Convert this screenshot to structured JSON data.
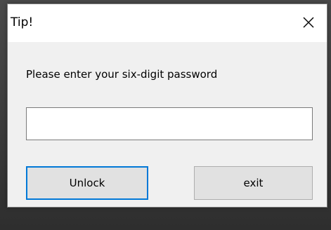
{
  "window": {
    "title": "Tip!",
    "close_icon": "close-icon"
  },
  "dialog": {
    "message": "Please enter your six-digit password",
    "password_value": "",
    "password_placeholder": ""
  },
  "buttons": {
    "unlock_label": "Unlock",
    "exit_label": "exit"
  },
  "colors": {
    "dialog_bg": "#f0f0f0",
    "titlebar_bg": "#ffffff",
    "focus_border": "#0078d7",
    "button_bg": "#e1e1e1"
  }
}
